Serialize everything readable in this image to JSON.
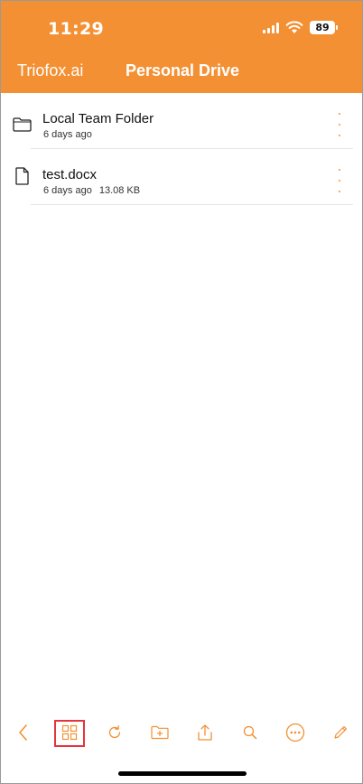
{
  "status_bar": {
    "time": "11:29",
    "battery": "89"
  },
  "header": {
    "back_label": "Triofox.ai",
    "title": "Personal Drive"
  },
  "files": [
    {
      "name": "Local Team Folder",
      "date": "6 days ago",
      "size": "",
      "icon": "folder-icon"
    },
    {
      "name": "test.docx",
      "date": "6 days ago",
      "size": "13.08 KB",
      "icon": "document-icon"
    }
  ],
  "toolbar": {
    "icons": [
      "back-chevron-icon",
      "grid-view-icon",
      "refresh-icon",
      "new-folder-icon",
      "upload-icon",
      "search-icon",
      "more-icon",
      "edit-icon"
    ]
  },
  "colors": {
    "accent": "#f39033",
    "highlight": "#e5343a"
  }
}
